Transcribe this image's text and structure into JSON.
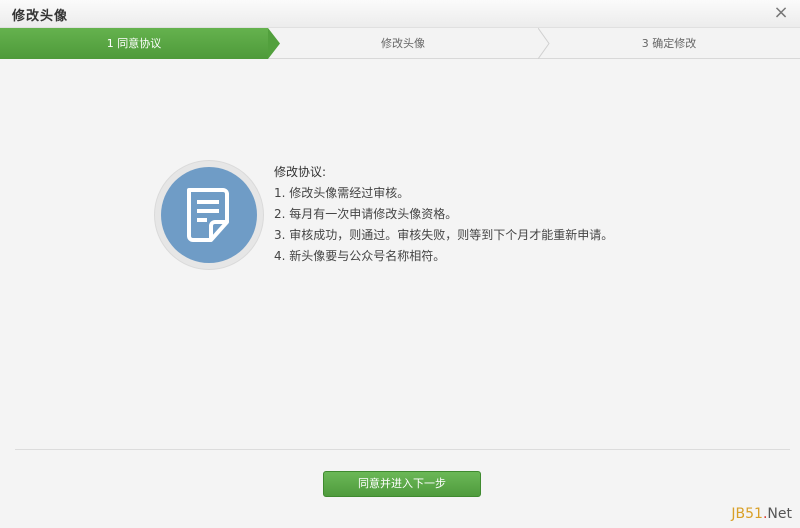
{
  "window": {
    "title": "修改头像",
    "close_label": "×"
  },
  "steps": [
    {
      "label": "1 同意协议",
      "active": true
    },
    {
      "label": "修改头像",
      "active": false
    },
    {
      "label": "3 确定修改",
      "active": false
    }
  ],
  "agreement": {
    "heading": "修改协议:",
    "items": [
      "1. 修改头像需经过审核。",
      "2. 每月有一次申请修改头像资格。",
      "3. 审核成功，则通过。审核失败，则等到下个月才能重新申请。",
      "4. 新头像要与公众号名称相符。"
    ]
  },
  "actions": {
    "agree_next_label": "同意并进入下一步"
  },
  "watermark": {
    "part1": "JB51",
    "dot": ".",
    "part2": "Net"
  },
  "colors": {
    "accent_green": "#5aa844",
    "icon_blue": "#6f9cc6"
  },
  "icons": {
    "document": "document-icon",
    "close": "close-icon"
  }
}
